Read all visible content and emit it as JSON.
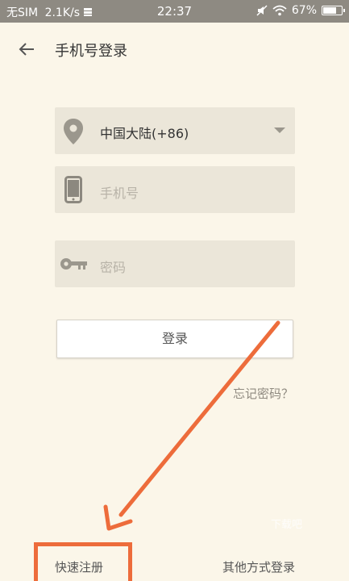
{
  "status_bar": {
    "carrier": "无SIM",
    "net_speed": "2.1K/s",
    "time": "22:37",
    "battery": "67%",
    "battery_level": 0.67,
    "icons": [
      "data-icon",
      "mute-icon",
      "wifi-icon",
      "battery-icon"
    ]
  },
  "header": {
    "title": "手机号登录",
    "back_icon": "arrow-left-icon"
  },
  "form": {
    "region": {
      "value": "中国大陆(+86)",
      "icon": "location-pin-icon",
      "chevron": "triangle-down-icon"
    },
    "phone": {
      "placeholder": "手机号",
      "icon": "phone-icon"
    },
    "password": {
      "placeholder": "密码",
      "icon": "key-icon"
    },
    "login_label": "登录",
    "forgot_label": "忘记密码？"
  },
  "bottom": {
    "register_label": "快速注册",
    "other_login_label": "其他方式登录"
  },
  "watermark": "下载吧",
  "colors": {
    "background": "#fbf6e9",
    "field_bg": "#ebe6d9",
    "annotation": "#ed6c3b",
    "status_bar": "#8e8a82"
  }
}
